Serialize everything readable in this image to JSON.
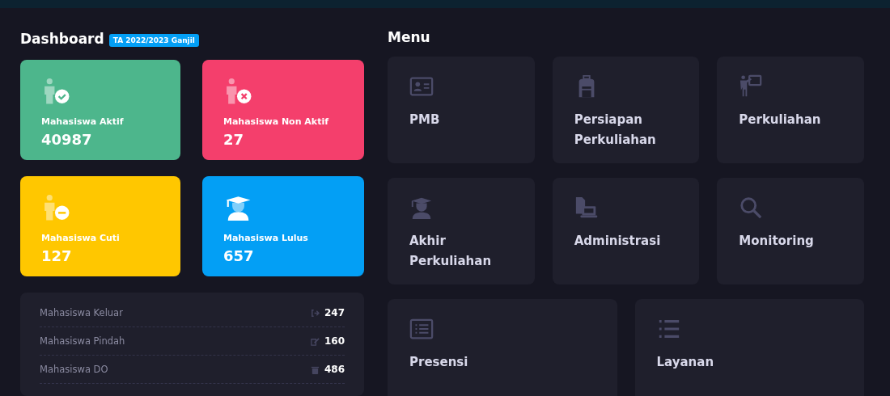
{
  "dashboard": {
    "title": "Dashboard",
    "badge": "TA 2022/2023 Ganjil",
    "stats": [
      {
        "kind": "active",
        "label": "Mahasiswa Aktif",
        "value": "40987",
        "color": "#4db68c"
      },
      {
        "kind": "inactive",
        "label": "Mahasiswa Non Aktif",
        "value": "27",
        "color": "#f43f6c"
      },
      {
        "kind": "leave",
        "label": "Mahasiswa Cuti",
        "value": "127",
        "color": "#ffc700"
      },
      {
        "kind": "graduate",
        "label": "Mahasiswa Lulus",
        "value": "657",
        "color": "#039ff5"
      }
    ],
    "list": [
      {
        "kind": "exit",
        "label": "Mahasiswa Keluar",
        "value": "247"
      },
      {
        "kind": "transfer",
        "label": "Mahasiswa Pindah",
        "value": "160"
      },
      {
        "kind": "dropout",
        "label": "Mahasiswa DO",
        "value": "486"
      }
    ]
  },
  "menu": {
    "title": "Menu",
    "items": [
      {
        "kind": "idcard",
        "label": "PMB"
      },
      {
        "kind": "bag",
        "label": "Persiapan Perkuliahan"
      },
      {
        "kind": "teacher",
        "label": "Perkuliahan"
      },
      {
        "kind": "graduate",
        "label": "Akhir Perkuliahan"
      },
      {
        "kind": "admin",
        "label": "Administrasi"
      },
      {
        "kind": "search",
        "label": "Monitoring"
      },
      {
        "kind": "listbox",
        "label": "Presensi"
      },
      {
        "kind": "list",
        "label": "Layanan"
      }
    ]
  }
}
